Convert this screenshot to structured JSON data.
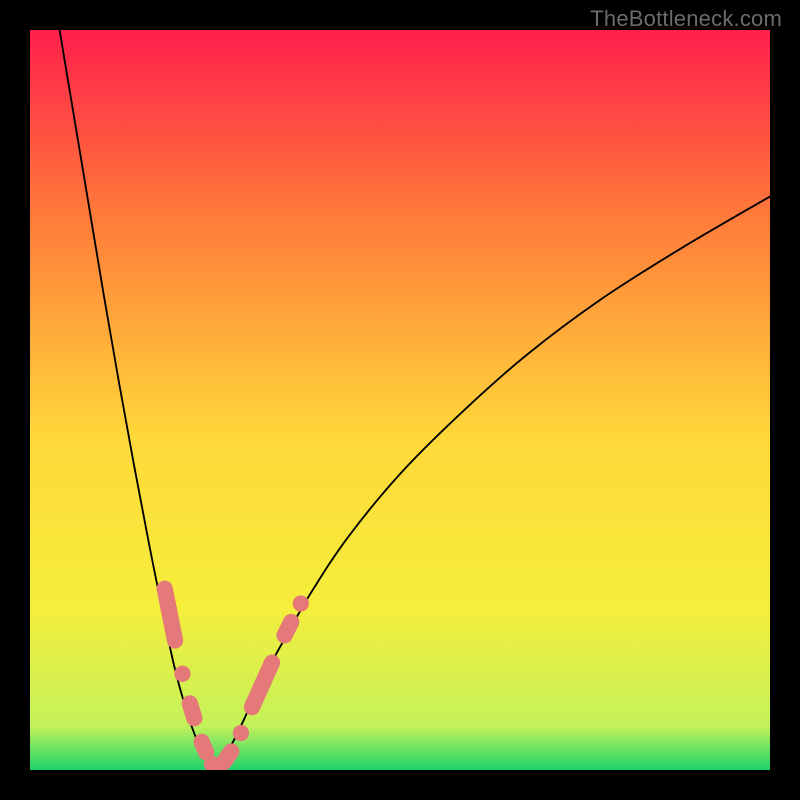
{
  "watermark": "TheBottleneck.com",
  "chart_data": {
    "type": "line",
    "title": "",
    "xlabel": "",
    "ylabel": "",
    "xlim": [
      0,
      100
    ],
    "ylim": [
      0,
      100
    ],
    "grid": false,
    "background_gradient_stops": [
      {
        "offset": 0.0,
        "color": "#ff1f4b"
      },
      {
        "offset": 0.25,
        "color": "#ff7a3a"
      },
      {
        "offset": 0.55,
        "color": "#ffd83a"
      },
      {
        "offset": 0.78,
        "color": "#f5ee3b"
      },
      {
        "offset": 0.94,
        "color": "#c4f25a"
      },
      {
        "offset": 1.0,
        "color": "#1ed36a"
      }
    ],
    "series": [
      {
        "name": "left-branch",
        "type": "curve",
        "x": [
          4,
          6,
          8,
          10,
          12,
          14,
          16,
          18,
          19.5,
          21,
          22.5,
          24,
          25
        ],
        "y": [
          100,
          88,
          76,
          64,
          52.5,
          41.5,
          31,
          21,
          14,
          8.5,
          4.2,
          1.4,
          0
        ]
      },
      {
        "name": "right-branch",
        "type": "curve",
        "x": [
          25,
          27,
          29,
          31,
          34,
          38,
          43,
          50,
          58,
          67,
          77,
          88,
          100
        ],
        "y": [
          0,
          3,
          7,
          11.5,
          17,
          24,
          31.5,
          40,
          48,
          56,
          63.5,
          70.5,
          77.5
        ]
      },
      {
        "name": "markers",
        "type": "scatter_segments",
        "segments": [
          {
            "points": [
              {
                "x": 18.2,
                "y": 24.5
              },
              {
                "x": 18.9,
                "y": 21.0
              },
              {
                "x": 19.6,
                "y": 17.5
              }
            ]
          },
          {
            "points": [
              {
                "x": 20.6,
                "y": 13.0
              }
            ]
          },
          {
            "points": [
              {
                "x": 21.6,
                "y": 9.0
              },
              {
                "x": 22.2,
                "y": 7.0
              }
            ]
          },
          {
            "points": [
              {
                "x": 23.2,
                "y": 3.8
              },
              {
                "x": 23.8,
                "y": 2.4
              }
            ]
          },
          {
            "points": [
              {
                "x": 24.6,
                "y": 0.8
              },
              {
                "x": 25.4,
                "y": 0.4
              },
              {
                "x": 26.3,
                "y": 1.2
              },
              {
                "x": 27.2,
                "y": 2.5
              }
            ]
          },
          {
            "points": [
              {
                "x": 28.5,
                "y": 5.0
              }
            ]
          },
          {
            "points": [
              {
                "x": 30.0,
                "y": 8.5
              },
              {
                "x": 30.9,
                "y": 10.5
              },
              {
                "x": 31.8,
                "y": 12.5
              },
              {
                "x": 32.7,
                "y": 14.5
              }
            ]
          },
          {
            "points": [
              {
                "x": 34.4,
                "y": 18.2
              },
              {
                "x": 35.3,
                "y": 20.0
              }
            ]
          },
          {
            "points": [
              {
                "x": 36.6,
                "y": 22.5
              }
            ]
          }
        ]
      }
    ],
    "annotations": []
  }
}
